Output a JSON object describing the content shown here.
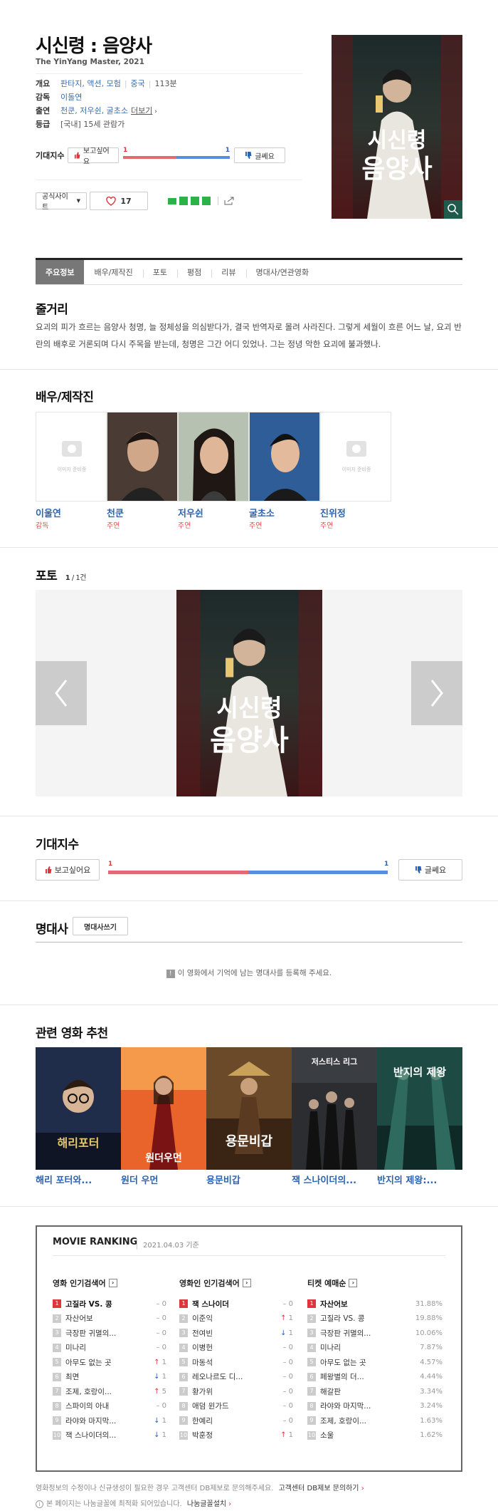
{
  "movie": {
    "title": "시신령 : 음양사",
    "subtitle": "The YinYang Master, 2021",
    "info": {
      "overview_label": "개요",
      "genres": "판타지, 액션, 모험",
      "country": "중국",
      "runtime": "113분",
      "director_label": "감독",
      "director": "이돌연",
      "cast_label": "출연",
      "cast": "천쿤, 저우쉰, 굴초소",
      "cast_more": "더보기",
      "rating_label": "등급",
      "rating": "[국내] 15세 관람가"
    },
    "expect_label": "기대지수",
    "want_label": "보고싶어요",
    "dislike_label": "글쎄요",
    "want_count": "1",
    "dislike_count": "1",
    "want_ratio": 0.5,
    "official_site_label": "공식사이트",
    "like_count": "17"
  },
  "tabs": [
    "주요정보",
    "배우/제작진",
    "포토",
    "평점",
    "리뷰",
    "명대사/연관영화"
  ],
  "synopsis": {
    "title": "줄거리",
    "text": "요괴의 피가 흐르는 음양사 청명, 늘 정체성을 의심받다가, 결국 반역자로 몰려 사라진다. 그렇게 세월이 흐른 어느 날, 요괴 반란의 배후로 거론되며 다시 주목을 받는데, 청명은 그간 어디 있었나. 그는 정녕 악한 요괴에 불과했나."
  },
  "cast_section": {
    "title": "배우/제작진",
    "no_image": "이미지 준비중",
    "people": [
      {
        "name": "이울연",
        "role": "감독"
      },
      {
        "name": "천쿤",
        "role": "주연"
      },
      {
        "name": "저우쉰",
        "role": "주연"
      },
      {
        "name": "굴초소",
        "role": "주연"
      },
      {
        "name": "진위정",
        "role": "주연"
      }
    ]
  },
  "photo": {
    "title": "포토",
    "count": "1",
    "total": "/ 1건"
  },
  "expect_section": {
    "title": "기대지수",
    "want_label": "보고싶어요",
    "dislike_label": "글쎄요",
    "want_count": "1",
    "dislike_count": "1",
    "want_ratio": 0.5
  },
  "quotes": {
    "title": "명대사",
    "write_label": "명대사쓰기",
    "empty_text": "이 영화에서 기억에 남는 명대사를 등록해 주세요."
  },
  "related": {
    "title": "관련 영화 추천",
    "movies": [
      {
        "name": "해리 포터와...",
        "poster_text": "해리포터"
      },
      {
        "name": "원더 우먼",
        "poster_text": "원더우먼"
      },
      {
        "name": "용문비갑",
        "poster_text": "용문비갑"
      },
      {
        "name": "잭 스나이더의...",
        "poster_text": "저스티스 리그"
      },
      {
        "name": "반지의 제왕:...",
        "poster_text": "반지의 제왕"
      }
    ]
  },
  "ranking": {
    "title": "MOVIE RANKING",
    "date": "2021.04.03 기준",
    "columns": [
      {
        "title": "영화 인기검색어",
        "items": [
          {
            "rank": "1",
            "title": "고질라 VS. 콩",
            "dir": "",
            "chg": "0"
          },
          {
            "rank": "2",
            "title": "자산어보",
            "dir": "",
            "chg": "0"
          },
          {
            "rank": "3",
            "title": "극장판 귀멸의...",
            "dir": "",
            "chg": "0"
          },
          {
            "rank": "4",
            "title": "미나리",
            "dir": "",
            "chg": "0"
          },
          {
            "rank": "5",
            "title": "아무도 없는 곳",
            "dir": "up",
            "chg": "1"
          },
          {
            "rank": "6",
            "title": "최면",
            "dir": "down",
            "chg": "1"
          },
          {
            "rank": "7",
            "title": "조제, 호랑이...",
            "dir": "up",
            "chg": "5"
          },
          {
            "rank": "8",
            "title": "스파이의 아내",
            "dir": "",
            "chg": "0"
          },
          {
            "rank": "9",
            "title": "라야와 마지막...",
            "dir": "down",
            "chg": "1"
          },
          {
            "rank": "10",
            "title": "잭 스나이더의...",
            "dir": "down",
            "chg": "1"
          }
        ]
      },
      {
        "title": "영화인 인기검색어",
        "items": [
          {
            "rank": "1",
            "title": "잭 스나이더",
            "dir": "",
            "chg": "0"
          },
          {
            "rank": "2",
            "title": "이준익",
            "dir": "up",
            "chg": "1"
          },
          {
            "rank": "3",
            "title": "전여빈",
            "dir": "down",
            "chg": "1"
          },
          {
            "rank": "4",
            "title": "이병헌",
            "dir": "",
            "chg": "0"
          },
          {
            "rank": "5",
            "title": "마동석",
            "dir": "",
            "chg": "0"
          },
          {
            "rank": "6",
            "title": "레오나르도 디...",
            "dir": "",
            "chg": "0"
          },
          {
            "rank": "7",
            "title": "황가위",
            "dir": "",
            "chg": "0"
          },
          {
            "rank": "8",
            "title": "애덤 윈가드",
            "dir": "",
            "chg": "0"
          },
          {
            "rank": "9",
            "title": "한예리",
            "dir": "",
            "chg": "0"
          },
          {
            "rank": "10",
            "title": "박훈정",
            "dir": "up",
            "chg": "1"
          }
        ]
      },
      {
        "title": "티켓 예매순",
        "items": [
          {
            "rank": "1",
            "title": "자산어보",
            "pct": "31.88%"
          },
          {
            "rank": "2",
            "title": "고질라 VS. 콩",
            "pct": "19.88%"
          },
          {
            "rank": "3",
            "title": "극장판 귀멸의...",
            "pct": "10.06%"
          },
          {
            "rank": "4",
            "title": "미나리",
            "pct": "7.87%"
          },
          {
            "rank": "5",
            "title": "아무도 없는 곳",
            "pct": "4.57%"
          },
          {
            "rank": "6",
            "title": "페왕별의 더...",
            "pct": "4.44%"
          },
          {
            "rank": "7",
            "title": "해갈판",
            "pct": "3.34%"
          },
          {
            "rank": "8",
            "title": "라야와 마지막...",
            "pct": "3.24%"
          },
          {
            "rank": "9",
            "title": "조제, 호랑이...",
            "pct": "1.63%"
          },
          {
            "rank": "10",
            "title": "소울",
            "pct": "1.62%"
          }
        ]
      }
    ]
  },
  "footer": {
    "notice": "영화정보의 수정이나 신규생성이 필요한 경우 고객센터 DB제보로 문의해주세요.",
    "notice_link": "고객센터 DB제보 문의하기",
    "font_notice": "본 페이지는 나눔글꼴에 최적화 되어있습니다.",
    "font_link": "나눔글꼴설치"
  },
  "colors": {
    "accent_blue": "#2d63b4",
    "want_red": "#e36a73",
    "dislike_blue": "#5b8ce0",
    "rank_red": "#e0353d"
  }
}
